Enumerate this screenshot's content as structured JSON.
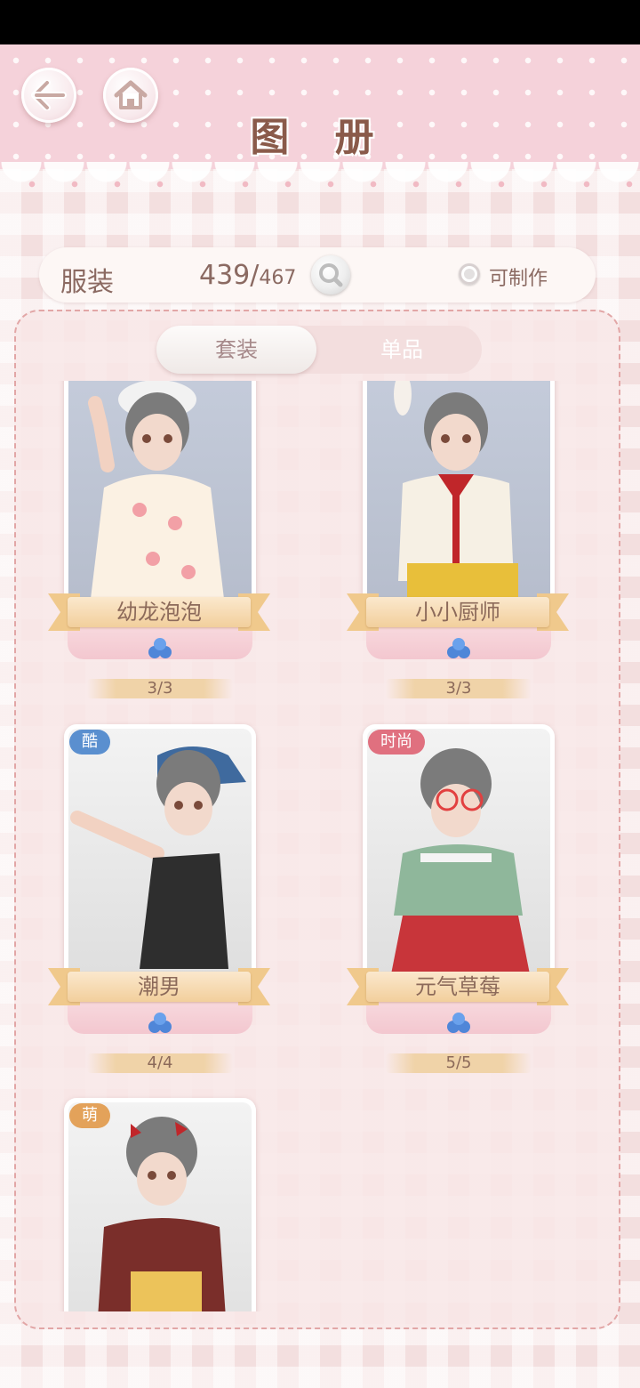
{
  "header": {
    "title": "图 册",
    "back_icon": "arrow-left-icon",
    "home_icon": "home-icon"
  },
  "stats": {
    "category_label": "服装",
    "collected": "439/",
    "total": "467",
    "craftable_label": "可制作"
  },
  "tabs": [
    {
      "label": "套装",
      "active": true
    },
    {
      "label": "单品",
      "active": false
    }
  ],
  "tag_colors": {
    "cool": "#5a8fcf",
    "fashion": "#e0707f",
    "cute": "#e3a25a"
  },
  "cards": [
    {
      "name": "幼龙泡泡",
      "progress": "3/3",
      "tag": ""
    },
    {
      "name": "小小厨师",
      "progress": "3/3",
      "tag": ""
    },
    {
      "name": "潮男",
      "progress": "4/4",
      "tag": "酷"
    },
    {
      "name": "元气草莓",
      "progress": "5/5",
      "tag": "时尚"
    },
    {
      "name": "",
      "progress": "",
      "tag": "萌"
    }
  ]
}
